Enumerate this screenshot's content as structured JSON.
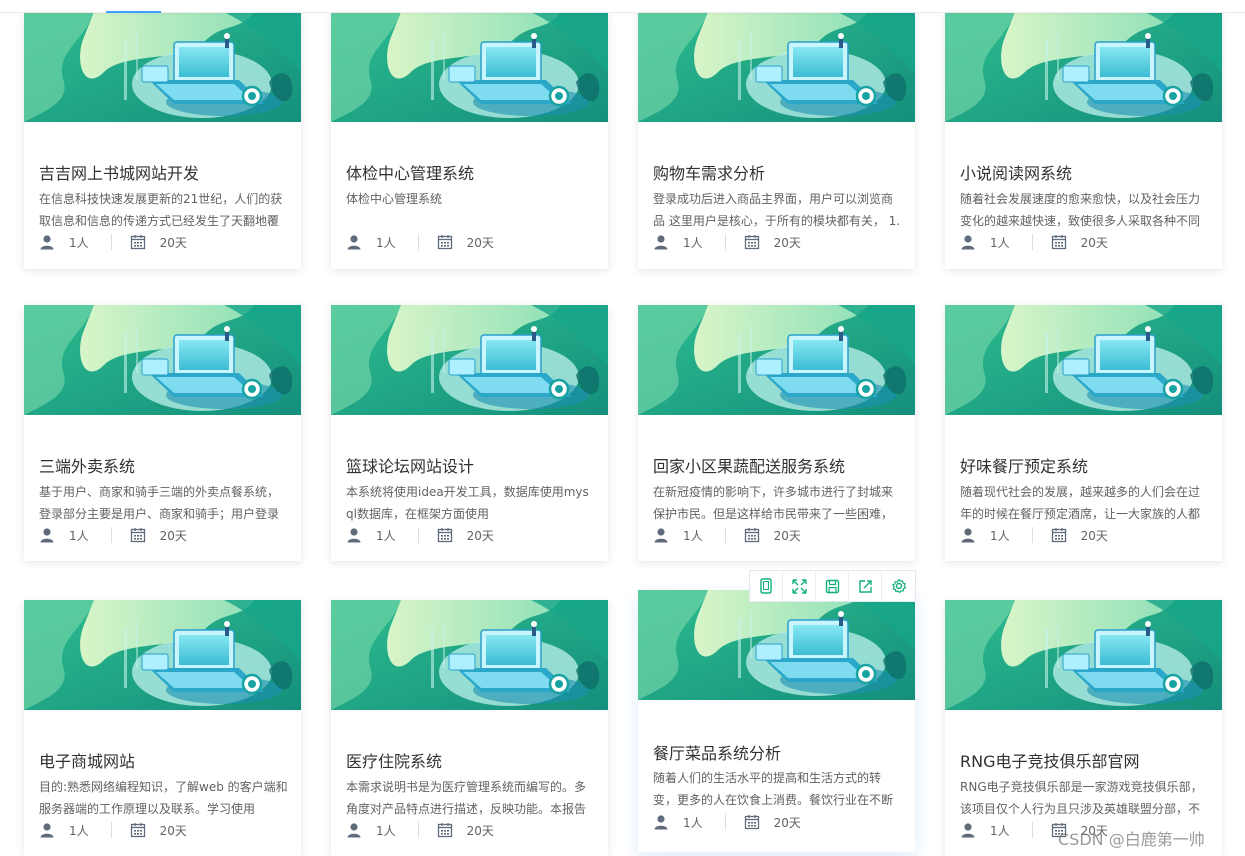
{
  "watermark": "CSDN @白鹿第一帅",
  "colors": {
    "accent": "#409eff",
    "banner_green": "#1fae8c",
    "icon_green": "#13b07a"
  },
  "toolbar_icons": [
    "tablet-icon",
    "fullscreen-icon",
    "save-icon",
    "share-icon",
    "settings-icon"
  ],
  "cards": [
    {
      "title": "吉吉网上书城网站开发",
      "desc": "在信息科技快速发展更新的21世纪，人们的获取信息和信息的传递方式已经发生了天翻地覆",
      "people": "1人",
      "days": "20天"
    },
    {
      "title": "体检中心管理系统",
      "desc": "体检中心管理系统",
      "people": "1人",
      "days": "20天"
    },
    {
      "title": "购物车需求分析",
      "desc": "登录成功后进入商品主界面，用户可以浏览商品 这里用户是核心，于所有的模块都有关， 1.",
      "people": "1人",
      "days": "20天"
    },
    {
      "title": "小说阅读网系统",
      "desc": "随着社会发展速度的愈来愈快，以及社会压力变化的越来越快速，致使很多人采取各种不同",
      "people": "1人",
      "days": "20天"
    },
    {
      "title": "三端外卖系统",
      "desc": "基于用户、商家和骑手三端的外卖点餐系统，登录部分主要是用户、商家和骑手；用户登录",
      "people": "1人",
      "days": "20天"
    },
    {
      "title": "篮球论坛网站设计",
      "desc": "本系统将使用idea开发工具，数据库使用mysql数据库，在框架方面使用",
      "people": "1人",
      "days": "20天"
    },
    {
      "title": "回家小区果蔬配送服务系统",
      "desc": "在新冠疫情的影响下，许多城市进行了封城来保护市民。但是这样给市民带来了一些困难，",
      "people": "1人",
      "days": "20天"
    },
    {
      "title": "好味餐厅预定系统",
      "desc": "随着现代社会的发展，越来越多的人们会在过年的时候在餐厅预定酒席，让一大家族的人都",
      "people": "1人",
      "days": "20天"
    },
    {
      "title": "电子商城网站",
      "desc": "目的:熟悉网络编程知识，了解web 的客户端和服务器端的工作原理以及联系。学习使用",
      "people": "1人",
      "days": "20天"
    },
    {
      "title": "医疗住院系统",
      "desc": "本需求说明书是为医疗管理系统而编写的。多角度对产品特点进行描述，反映功能。本报告",
      "people": "1人",
      "days": "20天"
    },
    {
      "title": "餐厅菜品系统分析",
      "desc": "随着人们的生活水平的提高和生活方式的转变，更多的人在饮食上消费。餐饮行业在不断",
      "people": "1人",
      "days": "20天"
    },
    {
      "title": "RNG电子竞技俱乐部官网",
      "desc": "RNG电子竞技俱乐部是一家游戏竞技俱乐部，该项目仅个人行为且只涉及英雄联盟分部，不",
      "people": "1人",
      "days": "20天"
    }
  ]
}
